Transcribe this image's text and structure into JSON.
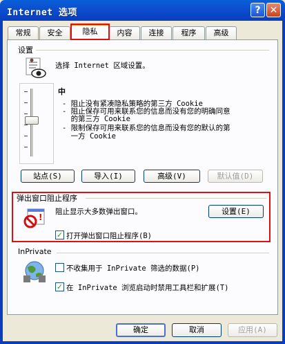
{
  "window": {
    "title": "Internet 选项",
    "help_glyph": "?",
    "close_glyph": "✕"
  },
  "tabs": [
    {
      "label": "常规",
      "active": false
    },
    {
      "label": "安全",
      "active": false
    },
    {
      "label": "隐私",
      "active": true
    },
    {
      "label": "内容",
      "active": false
    },
    {
      "label": "连接",
      "active": false
    },
    {
      "label": "程序",
      "active": false
    },
    {
      "label": "高级",
      "active": false
    }
  ],
  "settings": {
    "group_label": "设置",
    "description": "选择 Internet 区域设置。",
    "level": "中",
    "level_fraction": 0.55,
    "bullets": [
      "- 阻止没有紧凑隐私策略的第三方 Cookie",
      "- 阻止保存可用来联系您的信息而没有您的明确同意",
      "  的第三方 Cookie",
      "- 限制保存可用来联系您的信息而没有您的默认的第",
      "  一方 Cookie"
    ],
    "buttons": {
      "sites": "站点(S)",
      "import": "导入(I)",
      "advanced": "高级(V)",
      "default": "默认值(D)"
    }
  },
  "popup": {
    "group_label": "弹出窗口阻止程序",
    "description": "阻止显示大多数弹出窗口。",
    "settings_button": "设置(E)",
    "checkbox_label": "打开弹出窗口阻止程序(B)",
    "checked": true
  },
  "inprivate": {
    "group_label": "InPrivate",
    "checkbox1_label": "不收集用于 InPrivate 筛选的数据(P)",
    "checkbox1_checked": false,
    "checkbox2_label": "在 InPrivate 浏览启动时禁用工具栏和扩展(T)",
    "checkbox2_checked": true
  },
  "footer": {
    "ok": "确定",
    "cancel": "取消",
    "apply": "应用(A)"
  },
  "colors": {
    "title_bar": "#0a4fd0",
    "highlight_outline": "#dd1111",
    "check": "#21a121"
  }
}
